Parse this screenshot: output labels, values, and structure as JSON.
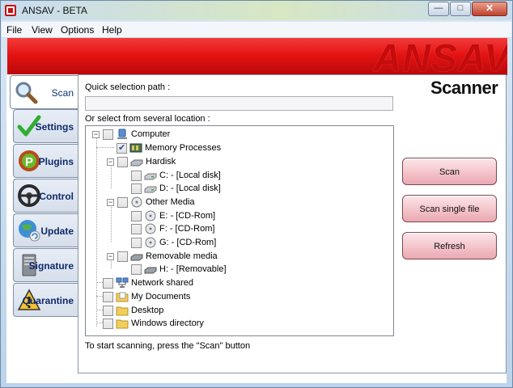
{
  "window": {
    "title": "ANSAV - BETA"
  },
  "menu": [
    "File",
    "View",
    "Options",
    "Help"
  ],
  "banner": {
    "logo": "ANSAV"
  },
  "tabs": [
    {
      "label": "Scan",
      "icon": "magnifier-icon",
      "active": true
    },
    {
      "label": "Settings",
      "icon": "checkmark-icon"
    },
    {
      "label": "Plugins",
      "icon": "plugin-icon"
    },
    {
      "label": "Control",
      "icon": "steering-wheel-icon"
    },
    {
      "label": "Update",
      "icon": "globe-update-icon"
    },
    {
      "label": "Signature",
      "icon": "server-icon"
    },
    {
      "label": "Quarantine",
      "icon": "warning-icon"
    }
  ],
  "scan": {
    "heading": "Scanner",
    "quick_label": "Quick selection path :",
    "quick_value": "",
    "or_select_label": "Or select from several location :",
    "hint": "To start scanning, press the \"Scan\" button"
  },
  "tree": [
    {
      "label": "Computer",
      "icon": "computer-icon",
      "checked": false
    },
    {
      "label": "Memory Processes",
      "icon": "memory-icon",
      "checked": true
    },
    {
      "label": "Hardisk",
      "icon": "harddisk-icon",
      "checked": false
    },
    {
      "label": "C: - [Local disk]",
      "icon": "drive-icon",
      "checked": false
    },
    {
      "label": "D: - [Local disk]",
      "icon": "drive-icon",
      "checked": false
    },
    {
      "label": "Other Media",
      "icon": "cdrom-icon",
      "checked": false
    },
    {
      "label": "E: - [CD-Rom]",
      "icon": "cdrom-icon",
      "checked": false
    },
    {
      "label": "F: - [CD-Rom]",
      "icon": "cdrom-icon",
      "checked": false
    },
    {
      "label": "G: - [CD-Rom]",
      "icon": "cdrom-icon",
      "checked": false
    },
    {
      "label": "Removable media",
      "icon": "removable-drive-icon",
      "checked": false
    },
    {
      "label": "H: - [Removable]",
      "icon": "removable-drive-icon",
      "checked": false
    },
    {
      "label": "Network shared",
      "icon": "network-icon",
      "checked": false
    },
    {
      "label": "My Documents",
      "icon": "documents-folder-icon",
      "checked": false
    },
    {
      "label": "Desktop",
      "icon": "folder-icon",
      "checked": false
    },
    {
      "label": "Windows directory",
      "icon": "folder-icon",
      "checked": false
    }
  ],
  "buttons": {
    "scan": "Scan",
    "scan_single": "Scan single file",
    "refresh": "Refresh"
  }
}
